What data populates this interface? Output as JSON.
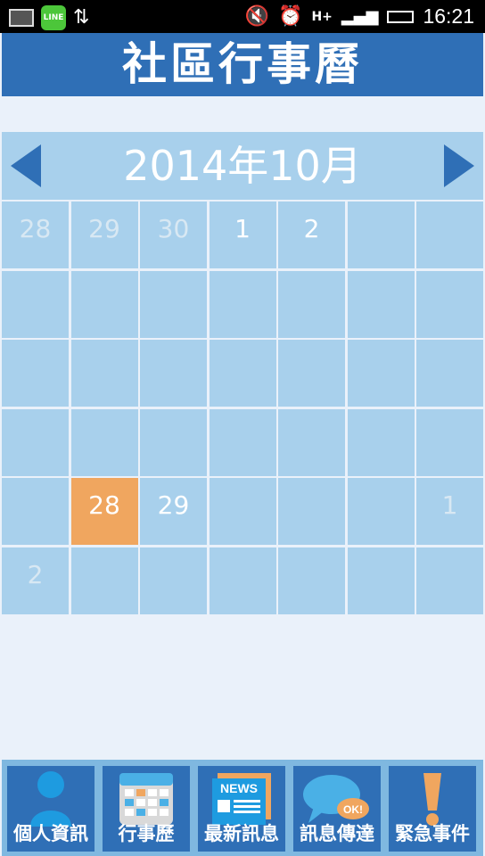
{
  "status_bar": {
    "time": "16:21",
    "icons": [
      "mail-icon",
      "line-app-icon",
      "data-sync-icon",
      "mute-icon",
      "alarm-icon",
      "hplus-icon",
      "signal-icon",
      "battery-icon"
    ],
    "line_text": "LINE"
  },
  "header": {
    "title": "社區行事曆"
  },
  "calendar": {
    "month_label": "2014年10月",
    "rows": [
      [
        {
          "day": "28",
          "other": true
        },
        {
          "day": "29",
          "other": true
        },
        {
          "day": "30",
          "other": true
        },
        {
          "day": "1"
        },
        {
          "day": "2"
        },
        {
          "day": ""
        },
        {
          "day": ""
        }
      ],
      [
        {
          "day": ""
        },
        {
          "day": ""
        },
        {
          "day": ""
        },
        {
          "day": ""
        },
        {
          "day": ""
        },
        {
          "day": ""
        },
        {
          "day": ""
        }
      ],
      [
        {
          "day": ""
        },
        {
          "day": ""
        },
        {
          "day": ""
        },
        {
          "day": ""
        },
        {
          "day": ""
        },
        {
          "day": ""
        },
        {
          "day": ""
        }
      ],
      [
        {
          "day": ""
        },
        {
          "day": ""
        },
        {
          "day": ""
        },
        {
          "day": ""
        },
        {
          "day": ""
        },
        {
          "day": ""
        },
        {
          "day": ""
        }
      ],
      [
        {
          "day": ""
        },
        {
          "day": "28",
          "today": true
        },
        {
          "day": "29"
        },
        {
          "day": ""
        },
        {
          "day": ""
        },
        {
          "day": ""
        },
        {
          "day": "1",
          "other": true
        }
      ],
      [
        {
          "day": "2",
          "other": true
        },
        {
          "day": ""
        },
        {
          "day": ""
        },
        {
          "day": ""
        },
        {
          "day": ""
        },
        {
          "day": ""
        },
        {
          "day": ""
        }
      ]
    ]
  },
  "bottom_nav": [
    {
      "label": "個人資訊",
      "icon": "person-icon"
    },
    {
      "label": "行事歷",
      "icon": "calendar-icon"
    },
    {
      "label": "最新訊息",
      "icon": "news-icon"
    },
    {
      "label": "訊息傳達",
      "icon": "chat-bubble-icon"
    },
    {
      "label": "緊急事件",
      "icon": "exclamation-icon"
    }
  ],
  "news_icon_text": "NEWS",
  "chat_icon_text": "OK!",
  "colors": {
    "primary": "#2f6fb6",
    "cell": "#a8d0ec",
    "today": "#f0a65f",
    "background": "#eaf1fa"
  }
}
